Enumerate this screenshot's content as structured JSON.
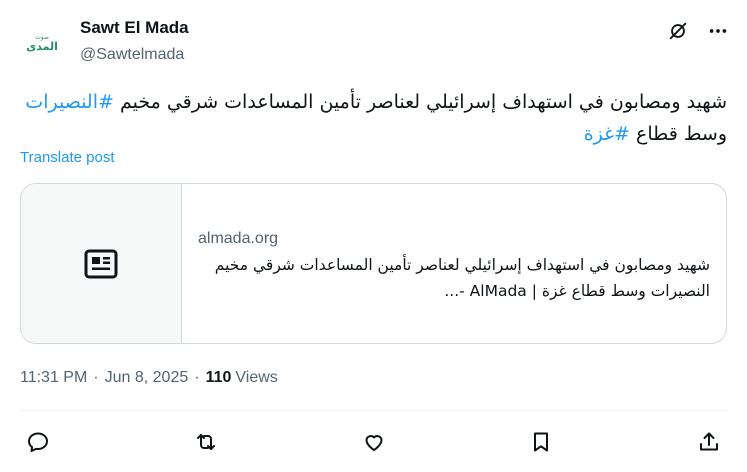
{
  "author": {
    "display_name": "Sawt El Mada",
    "handle": "@Sawtelmada",
    "avatar_icon": "almada-logo-icon",
    "brand_color": "#2a8c6e"
  },
  "header_actions": {
    "grok_icon": "grok-slash-icon",
    "more_icon": "more-dots-icon"
  },
  "tweet": {
    "text_main": "شهيد ومصابون في استهداف إسرائيلي لعناصر تأمين المساعدات شرقي مخيم",
    "hashtag_1": "#النصيرات",
    "text_mid": " وسط قطاع ",
    "hashtag_2": "#غزة"
  },
  "translate_label": "Translate post",
  "link_card": {
    "thumb_icon": "newspaper-icon",
    "domain": "almada.org",
    "description": "شهيد ومصابون في استهداف إسرائيلي لعناصر تأمين المساعدات شرقي مخيم النصيرات وسط قطاع غزة | AlMada -..."
  },
  "meta": {
    "time": "11:31 PM",
    "separator": "·",
    "date": "Jun 8, 2025",
    "views_count": "110",
    "views_label": "Views"
  },
  "colors": {
    "text": "#0f1419",
    "secondary": "#536471",
    "link": "#1d9bf0",
    "border": "#cfd9de"
  }
}
